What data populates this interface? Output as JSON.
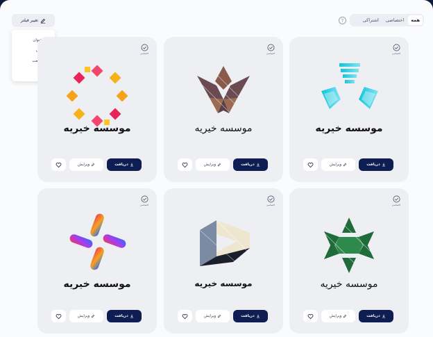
{
  "toolbar": {
    "filter_label": "تغییر فیلتر",
    "help_glyph": "?",
    "segments": [
      "همه",
      "اختصاصی",
      "اشتراکی"
    ]
  },
  "filter_menu": {
    "items": [
      "تغییر عنوان",
      "تغییر رنگ",
      "تغییر صنعت",
      "تغییر تگ"
    ]
  },
  "cards": [
    {
      "title": "موسسه خیریه",
      "badge": "اختصاصی",
      "download": "دریافت",
      "edit": "ویرایش",
      "logo": "triangle-stripes-logo"
    },
    {
      "title": "موسسه خیریه",
      "badge": "اختصاصی",
      "download": "دریافت",
      "edit": "ویرایش",
      "logo": "brown-bird-logo"
    },
    {
      "title": "موسسه خیریه",
      "badge": "اختصاصی",
      "download": "دریافت",
      "edit": "ویرایش",
      "logo": "colorful-ring-logo"
    },
    {
      "title": "موسسه خیریه",
      "badge": "اختصاصی",
      "download": "دریافت",
      "edit": "ویرایش",
      "logo": "green-star-logo"
    },
    {
      "title": "موسسه خیریه",
      "badge": "اختصاصی",
      "download": "دریافت",
      "edit": "ویرایش",
      "logo": "cube-prism-logo"
    },
    {
      "title": "موسسه خیریه",
      "badge": "اختصاصی",
      "download": "دریافت",
      "edit": "ویرایش",
      "logo": "gradient-cross-logo"
    }
  ],
  "colors": {
    "accent": "#0e1e52",
    "card_bg": "#eeeff3",
    "page_bg": "#fafbfd"
  }
}
